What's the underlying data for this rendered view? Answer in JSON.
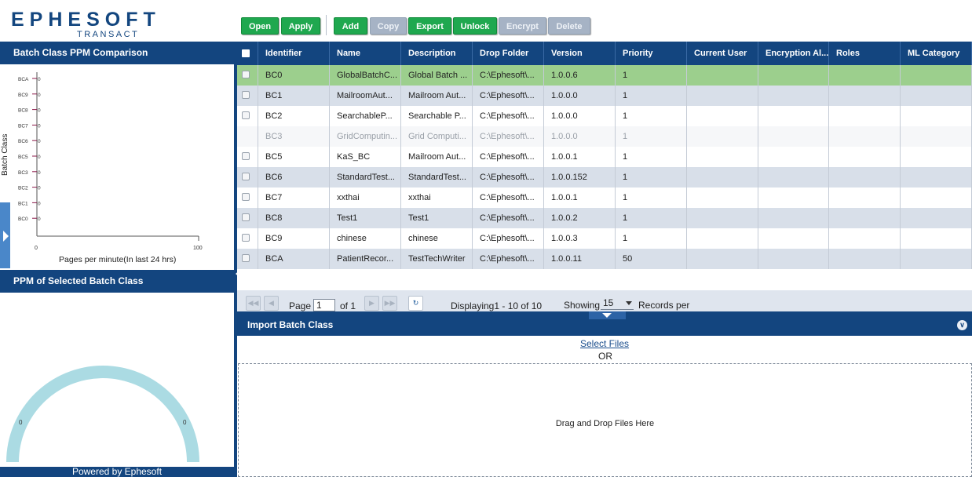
{
  "brand": {
    "word": "EPHESOFT",
    "sub": "TRANSACT"
  },
  "toolbar": {
    "buttons": [
      {
        "label": "Open",
        "enabled": true
      },
      {
        "label": "Apply",
        "enabled": true
      },
      {
        "label": "Add",
        "enabled": true
      },
      {
        "label": "Copy",
        "enabled": false
      },
      {
        "label": "Export",
        "enabled": true
      },
      {
        "label": "Unlock",
        "enabled": true
      },
      {
        "label": "Encrypt",
        "enabled": false
      },
      {
        "label": "Delete",
        "enabled": false
      }
    ]
  },
  "left_panel": {
    "ppm_title": "Batch Class PPM Comparison",
    "selected_title": "PPM of Selected Batch Class",
    "powered_by": "Powered by Ephesoft",
    "gauge": {
      "min_label": "0",
      "max_label": "0",
      "value": 0
    }
  },
  "chart_data": {
    "type": "bar",
    "orientation": "horizontal",
    "categories": [
      "BCA",
      "BC9",
      "BC8",
      "BC7",
      "BC6",
      "BC5",
      "BC3",
      "BC2",
      "BC1",
      "BC0"
    ],
    "values": [
      0,
      0,
      0,
      0,
      0,
      0,
      0,
      0,
      0,
      0
    ],
    "value_labels": [
      "0",
      "0",
      "0",
      "0",
      "0",
      "0",
      "0",
      "0",
      "0",
      "0"
    ],
    "ylabel": "Batch Class",
    "xlabel": "Pages per minute(In last 24 hrs)",
    "xlim": [
      0,
      100
    ],
    "x_ticks": [
      "0",
      "100"
    ],
    "bar_color": "#8b1a4a"
  },
  "grid": {
    "columns": [
      "Identifier",
      "Name",
      "Description",
      "Drop Folder",
      "Version",
      "Priority",
      "Current User",
      "Encryption Al...",
      "Roles",
      "ML Category"
    ],
    "rows": [
      {
        "id": "BC0",
        "name": "GlobalBatchC...",
        "desc": "Global Batch ...",
        "folder": "C:\\Ephesoft\\...",
        "version": "1.0.0.6",
        "priority": "1",
        "state": "selected"
      },
      {
        "id": "BC1",
        "name": "MailroomAut...",
        "desc": "Mailroom Aut...",
        "folder": "C:\\Ephesoft\\...",
        "version": "1.0.0.0",
        "priority": "1",
        "state": "alt"
      },
      {
        "id": "BC2",
        "name": "SearchableP...",
        "desc": "Searchable P...",
        "folder": "C:\\Ephesoft\\...",
        "version": "1.0.0.0",
        "priority": "1",
        "state": "normal"
      },
      {
        "id": "BC3",
        "name": "GridComputin...",
        "desc": "Grid Computi...",
        "folder": "C:\\Ephesoft\\...",
        "version": "1.0.0.0",
        "priority": "1",
        "state": "disabled"
      },
      {
        "id": "BC5",
        "name": "KaS_BC",
        "desc": "Mailroom Aut...",
        "folder": "C:\\Ephesoft\\...",
        "version": "1.0.0.1",
        "priority": "1",
        "state": "normal"
      },
      {
        "id": "BC6",
        "name": "StandardTest...",
        "desc": "StandardTest...",
        "folder": "C:\\Ephesoft\\...",
        "version": "1.0.0.152",
        "priority": "1",
        "state": "alt"
      },
      {
        "id": "BC7",
        "name": "xxthai",
        "desc": "xxthai",
        "folder": "C:\\Ephesoft\\...",
        "version": "1.0.0.1",
        "priority": "1",
        "state": "normal"
      },
      {
        "id": "BC8",
        "name": "Test1",
        "desc": "Test1",
        "folder": "C:\\Ephesoft\\...",
        "version": "1.0.0.2",
        "priority": "1",
        "state": "alt"
      },
      {
        "id": "BC9",
        "name": "chinese",
        "desc": "chinese",
        "folder": "C:\\Ephesoft\\...",
        "version": "1.0.0.3",
        "priority": "1",
        "state": "normal"
      },
      {
        "id": "BCA",
        "name": "PatientRecor...",
        "desc": "TestTechWriter",
        "folder": "C:\\Ephesoft\\...",
        "version": "1.0.0.11",
        "priority": "50",
        "state": "alt"
      }
    ]
  },
  "pager": {
    "page_label": "Page",
    "page_value": "1",
    "of_label": "of 1",
    "displaying": "Displaying1 - 10 of 10",
    "showing_label": "Showing",
    "page_size": "15",
    "records_label": "Records per"
  },
  "import": {
    "title": "Import Batch Class",
    "select_files": "Select Files",
    "or": "OR",
    "drop_text": "Drag and Drop Files Here"
  },
  "colors": {
    "navy": "#13457f",
    "green_button": "#1fa84f",
    "disabled_button": "#a6b3c5",
    "selected_row": "#9ccf8d",
    "alt_row": "#d8dfe9",
    "gauge": "#abdbe3"
  }
}
